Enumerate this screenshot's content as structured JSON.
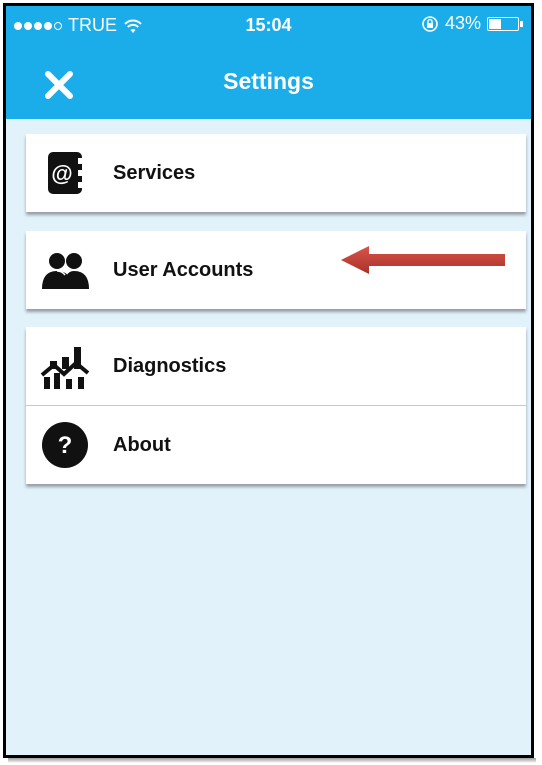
{
  "status_bar": {
    "carrier": "TRUE",
    "time": "15:04",
    "battery_percent": "43%",
    "battery_level": 0.43,
    "signal_dots_filled": 4,
    "signal_dots_total": 5
  },
  "nav": {
    "title": "Settings",
    "close_icon": "close-icon"
  },
  "menu": {
    "items": [
      {
        "label": "Services",
        "icon": "address-book-at-icon"
      },
      {
        "label": "User Accounts",
        "icon": "users-icon"
      },
      {
        "label": "Diagnostics",
        "icon": "chart-icon"
      },
      {
        "label": "About",
        "icon": "question-icon"
      }
    ]
  },
  "colors": {
    "header": "#1badea",
    "background": "#e2f2fb",
    "annotation_arrow": "#c0392b"
  }
}
